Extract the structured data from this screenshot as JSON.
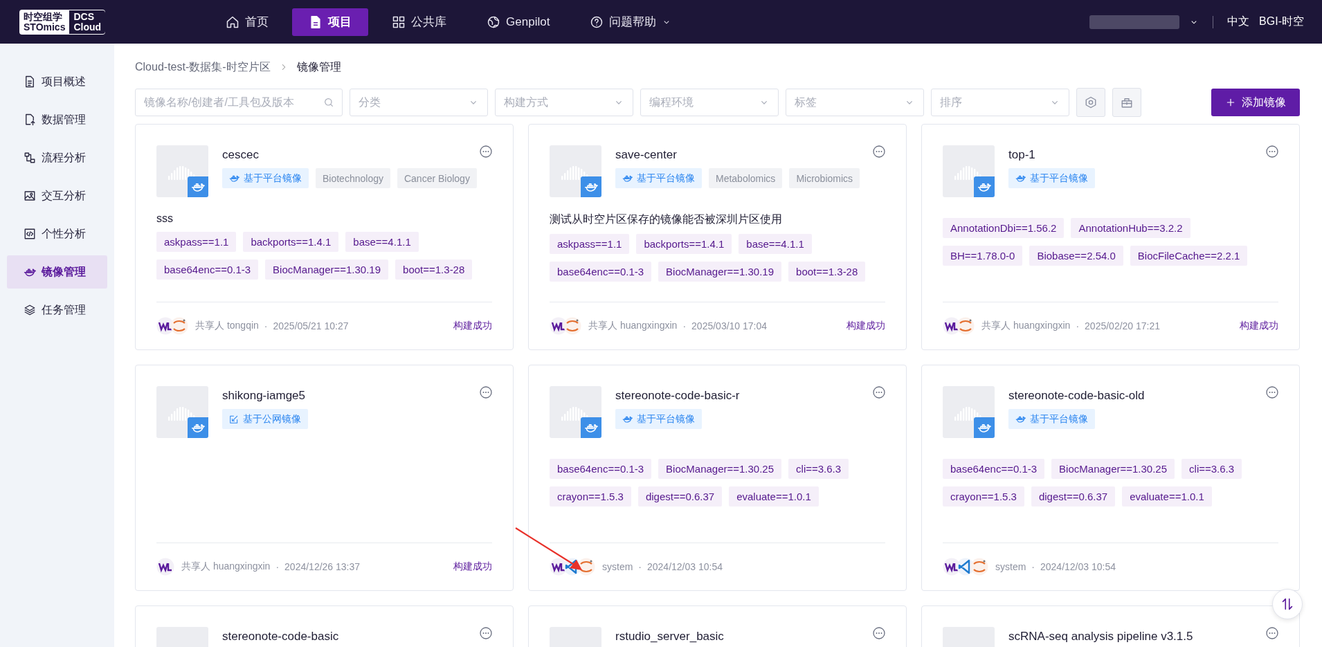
{
  "header": {
    "logo": {
      "line_1": "时空组学",
      "line_2": "STOmics",
      "product_1": "DCS",
      "product_2": "Cloud"
    },
    "nav": [
      {
        "label": "首页",
        "selected": false
      },
      {
        "label": "项目",
        "selected": true
      },
      {
        "label": "公共库",
        "selected": false
      },
      {
        "label": "Genpilot",
        "selected": false
      },
      {
        "label": "问题帮助",
        "selected": false,
        "dropdown": true
      }
    ],
    "language": "中文",
    "org": "BGI-时空"
  },
  "sidebar": {
    "items": [
      {
        "label": "项目概述",
        "selected": false
      },
      {
        "label": "数据管理",
        "selected": false
      },
      {
        "label": "流程分析",
        "selected": false
      },
      {
        "label": "交互分析",
        "selected": false
      },
      {
        "label": "个性分析",
        "selected": false
      },
      {
        "label": "镜像管理",
        "selected": true
      },
      {
        "label": "任务管理",
        "selected": false
      }
    ]
  },
  "breadcrumb": [
    "Cloud-test-数据集-时空片区",
    "镜像管理"
  ],
  "toolbar": {
    "search": {
      "placeholder": "镜像名称/创建者/工具包及版本"
    },
    "filters": [
      "分类",
      "构建方式",
      "编程环境",
      "标签",
      "排序"
    ],
    "add_button": "添加镜像"
  },
  "cards": [
    {
      "title": "cescec",
      "source": {
        "kind": "platform",
        "label": "基于平台镜像"
      },
      "tags": [
        "Biotechnology",
        "Cancer Biology"
      ],
      "description": "sss",
      "packages": [
        "askpass==1.1",
        "backports==1.4.1",
        "base==4.1.1",
        "base64enc==0.1-3",
        "BiocManager==1.30.19",
        "boot==1.3-28"
      ],
      "tools": [
        {
          "kind": "wdl"
        },
        {
          "kind": "jupyter"
        }
      ],
      "sharer": "共享人 tongqin",
      "separator": "·",
      "date": "2025/05/21 10:27",
      "status": "构建成功"
    },
    {
      "title": "save-center",
      "source": {
        "kind": "platform",
        "label": "基于平台镜像"
      },
      "tags": [
        "Metabolomics",
        "Microbiomics"
      ],
      "description": "测试从时空片区保存的镜像能否被深圳片区使用",
      "packages": [
        "askpass==1.1",
        "backports==1.4.1",
        "base==4.1.1",
        "base64enc==0.1-3",
        "BiocManager==1.30.19",
        "boot==1.3-28"
      ],
      "tools": [
        {
          "kind": "wdl"
        },
        {
          "kind": "jupyter"
        }
      ],
      "sharer": "共享人 huangxingxin",
      "separator": "·",
      "date": "2025/03/10 17:04",
      "status": "构建成功"
    },
    {
      "title": "top-1",
      "source": {
        "kind": "platform",
        "label": "基于平台镜像"
      },
      "packages": [
        "AnnotationDbi==1.56.2",
        "AnnotationHub==3.2.2",
        "BH==1.78.0-0",
        "Biobase==2.54.0",
        "BiocFileCache==2.2.1"
      ],
      "tools": [
        {
          "kind": "wdl"
        },
        {
          "kind": "jupyter"
        }
      ],
      "sharer": "共享人 huangxingxin",
      "separator": "·",
      "date": "2025/02/20 17:21",
      "status": "构建成功"
    },
    {
      "title": "shikong-iamge5",
      "source": {
        "kind": "public",
        "label": "基于公网镜像"
      },
      "tools": [
        {
          "kind": "wdl"
        }
      ],
      "sharer": "共享人 huangxingxin",
      "separator": "·",
      "date": "2024/12/26 13:37",
      "status": "构建成功"
    },
    {
      "title": "stereonote-code-basic-r",
      "source": {
        "kind": "platform",
        "label": "基于平台镜像"
      },
      "packages": [
        "base64enc==0.1-3",
        "BiocManager==1.30.25",
        "cli==3.6.3",
        "crayon==1.5.3",
        "digest==0.6.37",
        "evaluate==1.0.1"
      ],
      "tools": [
        {
          "kind": "wdl"
        },
        {
          "kind": "vscode"
        },
        {
          "kind": "jupyter"
        }
      ],
      "sharer": "system",
      "separator": "·",
      "date": "2024/12/03 10:54"
    },
    {
      "title": "stereonote-code-basic-old",
      "source": {
        "kind": "platform",
        "label": "基于平台镜像"
      },
      "packages": [
        "base64enc==0.1-3",
        "BiocManager==1.30.25",
        "cli==3.6.3",
        "crayon==1.5.3",
        "digest==0.6.37",
        "evaluate==1.0.1"
      ],
      "tools": [
        {
          "kind": "wdl"
        },
        {
          "kind": "vscode"
        },
        {
          "kind": "jupyter"
        }
      ],
      "sharer": "system",
      "separator": "·",
      "date": "2024/12/03 10:54"
    },
    {
      "title": "stereonote-code-basic"
    },
    {
      "title": "rstudio_server_basic"
    },
    {
      "title": "scRNA-seq analysis pipeline v3.1.5"
    }
  ]
}
